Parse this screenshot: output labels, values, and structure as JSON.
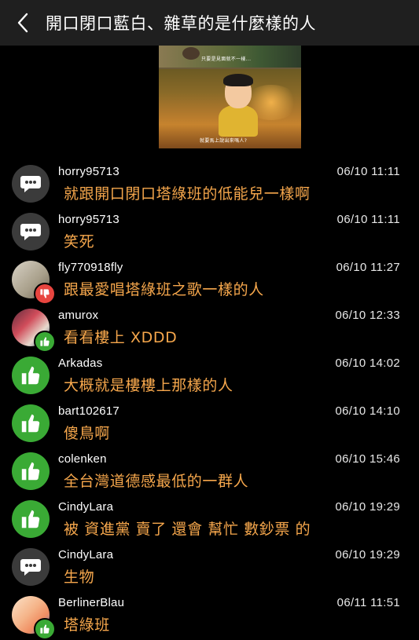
{
  "header": {
    "back_icon": "chevron-left-icon",
    "title": "開口閉口藍白、雜草的是什麼樣的人"
  },
  "preview": {
    "caption_top": "只要是見面就不一樣...",
    "caption_bottom": "就要馬上說出來嗎人?"
  },
  "comments": [
    {
      "user": "horry95713",
      "time": "06/10 11:11",
      "text": "就跟開口閉口塔綠班的低能兒一樣啊",
      "avatar": "comment-bubble-icon"
    },
    {
      "user": "horry95713",
      "time": "06/10 11:11",
      "text": "笑死",
      "avatar": "comment-bubble-icon"
    },
    {
      "user": "fly770918fly",
      "time": "06/10 11:27",
      "text": "跟最愛唱塔綠班之歌一樣的人",
      "avatar": "user-photo",
      "badge": "thumbs-down-icon"
    },
    {
      "user": "amurox",
      "time": "06/10 12:33",
      "text": "看看樓上 XDDD",
      "avatar": "user-photo",
      "badge": "thumbs-up-icon"
    },
    {
      "user": "Arkadas",
      "time": "06/10 14:02",
      "text": "大概就是樓樓上那樣的人",
      "avatar": "thumbs-up-icon"
    },
    {
      "user": "bart102617",
      "time": "06/10 14:10",
      "text": "傻鳥啊",
      "avatar": "thumbs-up-icon"
    },
    {
      "user": "colenken",
      "time": "06/10 15:46",
      "text": "全台灣道德感最低的一群人",
      "avatar": "thumbs-up-icon"
    },
    {
      "user": "CindyLara",
      "time": "06/10 19:29",
      "text": "被 資進黨 賣了 還會 幫忙 數鈔票 的",
      "avatar": "thumbs-up-icon"
    },
    {
      "user": "CindyLara",
      "time": "06/10 19:29",
      "text": "生物",
      "avatar": "comment-bubble-icon"
    },
    {
      "user": "BerlinerBlau",
      "time": "06/11 11:51",
      "text": "塔綠班",
      "avatar": "user-photo",
      "badge": "thumbs-up-icon"
    }
  ]
}
